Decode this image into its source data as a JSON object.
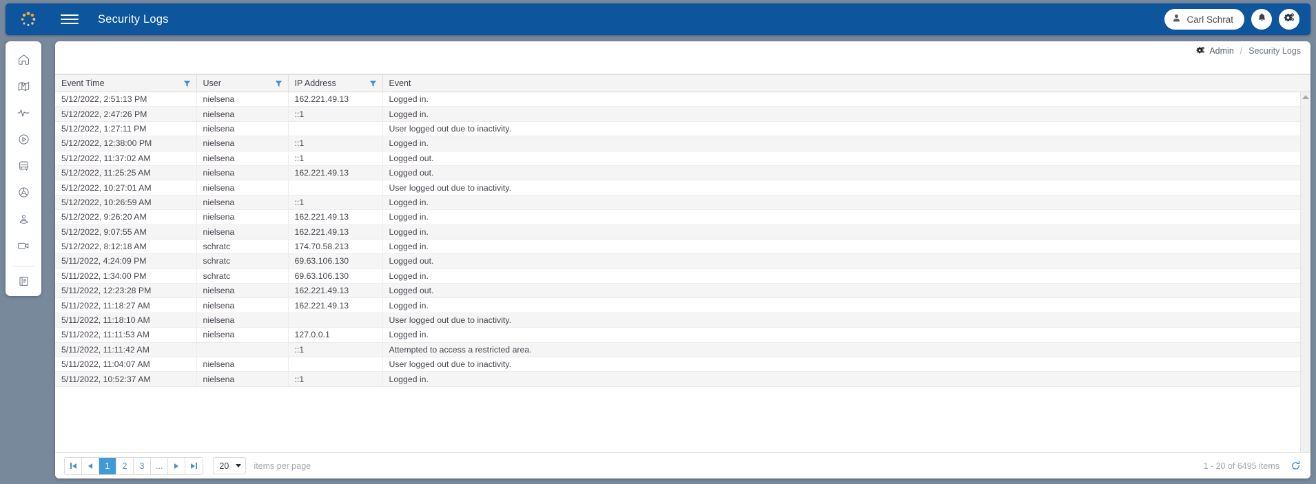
{
  "header": {
    "title": "Security Logs",
    "logo_icon": "spinner-logo-icon",
    "menu_icon": "hamburger-menu-icon",
    "user_name": "Carl Schrat",
    "user_icon": "person-icon",
    "notifications_icon": "bell-icon",
    "settings_icon": "gears-icon",
    "accent_color": "#0d559c"
  },
  "sidebar": {
    "items": [
      {
        "icon": "home-icon",
        "label": "Home"
      },
      {
        "icon": "map-marker-icon",
        "label": "Map"
      },
      {
        "icon": "pulse-activity-icon",
        "label": "Activity"
      },
      {
        "icon": "play-circle-icon",
        "label": "Playback"
      },
      {
        "icon": "bus-icon",
        "label": "Vehicles"
      },
      {
        "icon": "steering-wheel-icon",
        "label": "Drivers"
      },
      {
        "icon": "person-pin-icon",
        "label": "Passengers"
      },
      {
        "icon": "video-camera-icon",
        "label": "Video"
      }
    ],
    "bottom_items": [
      {
        "icon": "report-book-icon",
        "label": "Reports"
      }
    ]
  },
  "breadcrumb": {
    "icon": "gears-icon",
    "root": "Admin",
    "separator": "/",
    "current": "Security Logs"
  },
  "table": {
    "columns": [
      {
        "label": "Event Time",
        "filter_icon": "filter-funnel-icon"
      },
      {
        "label": "User",
        "filter_icon": "filter-funnel-icon"
      },
      {
        "label": "IP Address",
        "filter_icon": "filter-funnel-icon"
      },
      {
        "label": "Event",
        "filter_icon": null
      }
    ],
    "rows": [
      {
        "time": "5/12/2022, 2:51:13 PM",
        "user": "nielsena",
        "ip": "162.221.49.13",
        "event": "Logged in."
      },
      {
        "time": "5/12/2022, 2:47:26 PM",
        "user": "nielsena",
        "ip": "::1",
        "event": "Logged in."
      },
      {
        "time": "5/12/2022, 1:27:11 PM",
        "user": "nielsena",
        "ip": "",
        "event": "User logged out due to inactivity."
      },
      {
        "time": "5/12/2022, 12:38:00 PM",
        "user": "nielsena",
        "ip": "::1",
        "event": "Logged in."
      },
      {
        "time": "5/12/2022, 11:37:02 AM",
        "user": "nielsena",
        "ip": "::1",
        "event": "Logged out."
      },
      {
        "time": "5/12/2022, 11:25:25 AM",
        "user": "nielsena",
        "ip": "162.221.49.13",
        "event": "Logged out."
      },
      {
        "time": "5/12/2022, 10:27:01 AM",
        "user": "nielsena",
        "ip": "",
        "event": "User logged out due to inactivity."
      },
      {
        "time": "5/12/2022, 10:26:59 AM",
        "user": "nielsena",
        "ip": "::1",
        "event": "Logged in."
      },
      {
        "time": "5/12/2022, 9:26:20 AM",
        "user": "nielsena",
        "ip": "162.221.49.13",
        "event": "Logged in."
      },
      {
        "time": "5/12/2022, 9:07:55 AM",
        "user": "nielsena",
        "ip": "162.221.49.13",
        "event": "Logged in."
      },
      {
        "time": "5/12/2022, 8:12:18 AM",
        "user": "schratc",
        "ip": "174.70.58.213",
        "event": "Logged in."
      },
      {
        "time": "5/11/2022, 4:24:09 PM",
        "user": "schratc",
        "ip": "69.63.106.130",
        "event": "Logged out."
      },
      {
        "time": "5/11/2022, 1:34:00 PM",
        "user": "schratc",
        "ip": "69.63.106.130",
        "event": "Logged in."
      },
      {
        "time": "5/11/2022, 12:23:28 PM",
        "user": "nielsena",
        "ip": "162.221.49.13",
        "event": "Logged out."
      },
      {
        "time": "5/11/2022, 11:18:27 AM",
        "user": "nielsena",
        "ip": "162.221.49.13",
        "event": "Logged in."
      },
      {
        "time": "5/11/2022, 11:18:10 AM",
        "user": "nielsena",
        "ip": "",
        "event": "User logged out due to inactivity."
      },
      {
        "time": "5/11/2022, 11:11:53 AM",
        "user": "nielsena",
        "ip": "127.0.0.1",
        "event": "Logged in."
      },
      {
        "time": "5/11/2022, 11:11:42 AM",
        "user": "",
        "ip": "::1",
        "event": "Attempted to access a restricted area."
      },
      {
        "time": "5/11/2022, 11:04:07 AM",
        "user": "nielsena",
        "ip": "",
        "event": "User logged out due to inactivity."
      },
      {
        "time": "5/11/2022, 10:52:37 AM",
        "user": "nielsena",
        "ip": "::1",
        "event": "Logged in."
      }
    ]
  },
  "pager": {
    "first_icon": "go-to-first-page-icon",
    "prev_icon": "previous-page-icon",
    "pages": [
      "1",
      "2",
      "3"
    ],
    "ellipsis": "...",
    "next_icon": "next-page-icon",
    "last_icon": "go-to-last-page-icon",
    "active_page": "1",
    "page_size": "20",
    "page_size_label": "items per page",
    "item_count": "1 - 20 of 6495 items",
    "refresh_icon": "refresh-icon",
    "active_color": "#3f9ad6"
  }
}
